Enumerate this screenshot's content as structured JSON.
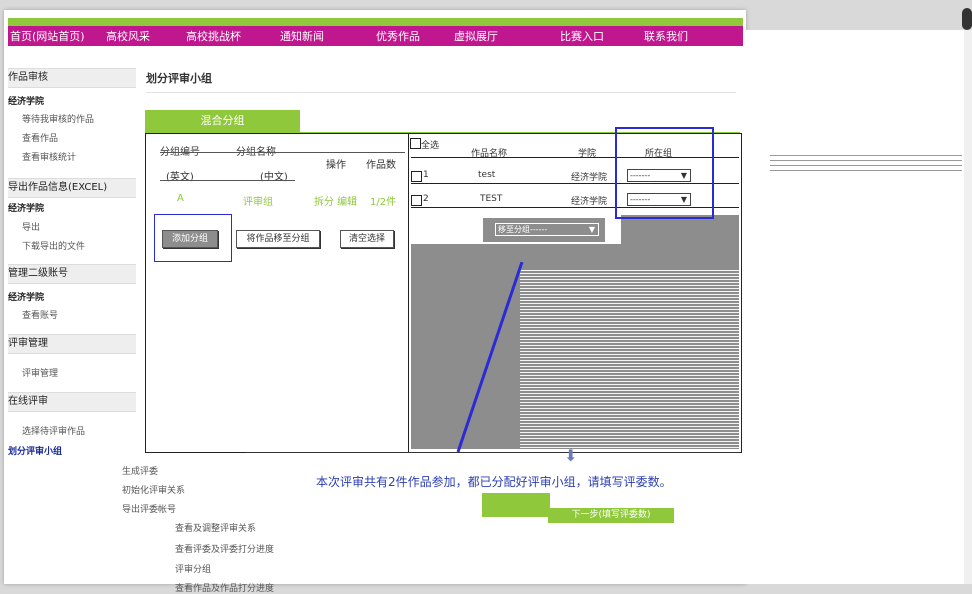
{
  "nav": {
    "items": [
      "首页(网站首页)",
      "高校风采",
      "高校挑战杯",
      "通知新闻",
      "优秀作品",
      "虚拟展厅",
      "比赛入口",
      "联系我们"
    ]
  },
  "sidebar": {
    "sections": [
      {
        "head": "作品审核",
        "sub": "经济学院",
        "items": [
          "等待我审核的作品",
          "查看作品",
          "查看审核统计"
        ]
      },
      {
        "head": "导出作品信息(EXCEL)",
        "sub": "经济学院",
        "items": [
          "导出",
          "下载导出的文件"
        ]
      },
      {
        "head": "管理二级账号",
        "sub": "经济学院",
        "items": [
          "查看账号"
        ]
      },
      {
        "head": "评审管理",
        "sub": "",
        "items": [
          "评审管理"
        ]
      },
      {
        "head": "在线评审",
        "sub": "",
        "items": [
          "选择待评审作品"
        ]
      }
    ]
  },
  "panel": {
    "title": "划分评审小组",
    "tab": "混合分组",
    "left": {
      "col1": "分组编号",
      "col2": "分组名称",
      "col3": "操作",
      "col4": "作品数",
      "sub1": "(英文)",
      "sub2": "(中文)",
      "row_id": "A",
      "row_name": "评审组",
      "row_ops": "拆分 编辑",
      "row_count": "1/2件",
      "btn1": "添加分组",
      "btn2": "将作品移至分组",
      "btn3": "清空选择"
    },
    "right": {
      "h_all": "全选",
      "h_name": "作品名称",
      "h_college": "学院",
      "h_group": "所在组",
      "rows": [
        {
          "num": "1",
          "name": "test",
          "college": "经济学院",
          "group": "-------"
        },
        {
          "num": "2",
          "name": "TEST",
          "college": "经济学院",
          "group": "-------"
        }
      ],
      "move_select": "移至分组------"
    }
  },
  "bottom": {
    "message": "本次评审共有2件作品参加，都已分配好评审小组，请填写评委数。",
    "next_button": "下一步(填写评委数)"
  },
  "menu": {
    "head": "划分评审小组",
    "items": [
      "生成评委",
      "初始化评审关系",
      "导出评委帐号"
    ],
    "subitems": [
      "查看及调整评审关系",
      "查看评委及评委打分进度",
      "评审分组",
      "查看作品及作品打分进度"
    ]
  },
  "colors": {
    "accent_green": "#8fc83a",
    "nav_magenta": "#c0178f",
    "highlight_blue": "#2b2bd6"
  }
}
